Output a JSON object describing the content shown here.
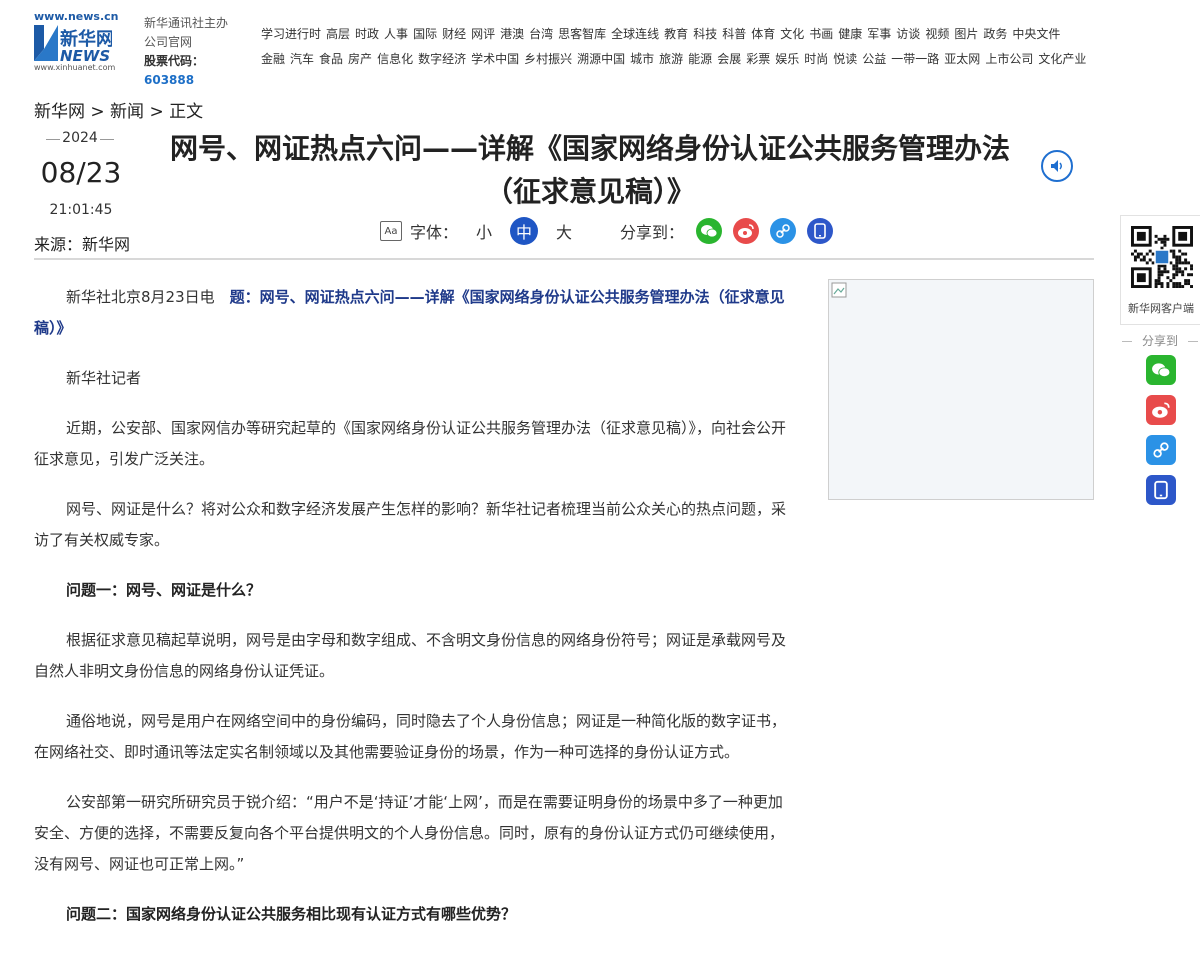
{
  "header": {
    "logo_url": "www.news.cn",
    "logo_cn": "新华网",
    "logo_en": "NEWS",
    "logo_url2": "www.xinhuanet.com",
    "sponsor_line1": "新华通讯社主办",
    "sponsor_line2": "公司官网",
    "stock_label": "股票代码：",
    "stock_code": "603888",
    "nav_row1": [
      "学习进行时",
      "高层",
      "时政",
      "人事",
      "国际",
      "财经",
      "网评",
      "港澳",
      "台湾",
      "思客智库",
      "全球连线",
      "教育",
      "科技",
      "科普",
      "体育",
      "文化",
      "书画",
      "健康",
      "军事",
      "访谈",
      "视频",
      "图片",
      "政务",
      "中央文件"
    ],
    "nav_row2": [
      "金融",
      "汽车",
      "食品",
      "房产",
      "信息化",
      "数字经济",
      "学术中国",
      "乡村振兴",
      "溯源中国",
      "城市",
      "旅游",
      "能源",
      "会展",
      "彩票",
      "娱乐",
      "时尚",
      "悦读",
      "公益",
      "一带一路",
      "亚太网",
      "上市公司",
      "文化产业"
    ]
  },
  "breadcrumb": "新华网 > 新闻 > 正文",
  "date": {
    "year": "2024",
    "month_day": "08/23",
    "time": "21:01:45"
  },
  "source": "来源：新华网",
  "title": {
    "line1": "网号、网证热点六问——详解《国家网络身份认证公共服务管理办法",
    "line2": "（征求意见稿）》"
  },
  "toolbar": {
    "font_icon": "Aa",
    "font_label": "字体：",
    "size_small": "小",
    "size_medium": "中",
    "size_large": "大",
    "share_label": "分享到："
  },
  "article": {
    "dateline_prefix": "新华社北京8月23日电　",
    "dateline_lead": "题：网号、网证热点六问——详解《国家网络身份认证公共服务管理办法（征求意见稿）》",
    "p1": "新华社记者",
    "p2": "近期，公安部、国家网信办等研究起草的《国家网络身份认证公共服务管理办法（征求意见稿）》，向社会公开征求意见，引发广泛关注。",
    "p3": "网号、网证是什么？将对公众和数字经济发展产生怎样的影响？新华社记者梳理当前公众关心的热点问题，采访了有关权威专家。",
    "q1": "问题一：网号、网证是什么？",
    "p4": "根据征求意见稿起草说明，网号是由字母和数字组成、不含明文身份信息的网络身份符号；网证是承载网号及自然人非明文身份信息的网络身份认证凭证。",
    "p5": "通俗地说，网号是用户在网络空间中的身份编码，同时隐去了个人身份信息；网证是一种简化版的数字证书，在网络社交、即时通讯等法定实名制领域以及其他需要验证身份的场景，作为一种可选择的身份认证方式。",
    "p6": "公安部第一研究所研究员于锐介绍：“用户不是‘持证’才能‘上网’，而是在需要证明身份的场景中多了一种更加安全、方便的选择，不需要反复向各个平台提供明文的个人身份信息。同时，原有的身份认证方式仍可继续使用，没有网号、网证也可正常上网。”",
    "q2": "问题二：国家网络身份认证公共服务相比现有认证方式有哪些优势？"
  },
  "rail": {
    "client_label": "新华网客户端",
    "share_label": "分享到"
  },
  "colors": {
    "brand_blue": "#1d5aa6",
    "active_blue": "#1f56c4",
    "wechat": "#2ab52f",
    "weibo": "#e84b4b",
    "link": "#2b92e6",
    "mobile": "#2d57c9"
  }
}
